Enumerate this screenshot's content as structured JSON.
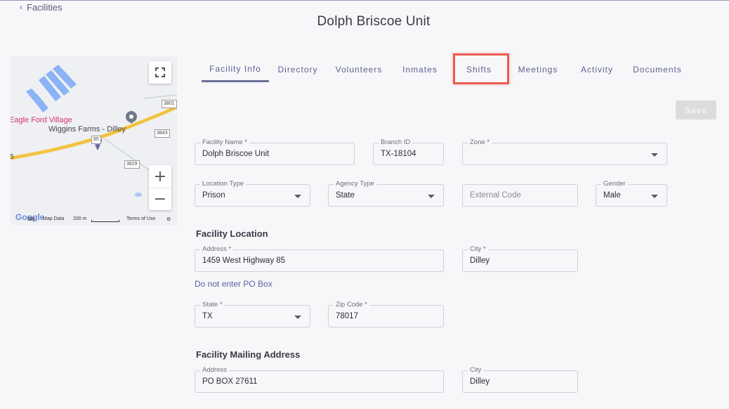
{
  "nav": {
    "back_label": "Facilities"
  },
  "page": {
    "title": "Dolph Briscoe Unit"
  },
  "map": {
    "place_label_1": "Eagle Ford Village",
    "place_label_2": "Wiggins Farms - Dilley",
    "edge_label": "5",
    "road_signs": [
      "3801",
      "3843",
      "85",
      "3829"
    ],
    "map_data_label": "Map Data",
    "scale_label": "200 m",
    "terms_label": "Terms of Use",
    "logo_text": "Google",
    "zoom_in": "+",
    "zoom_out": "−"
  },
  "tabs": [
    "Facility Info",
    "Directory",
    "Volunteers",
    "Inmates",
    "Shifts",
    "Meetings",
    "Activity",
    "Documents"
  ],
  "active_tab": "Facility Info",
  "highlighted_tab": "Shifts",
  "save_label": "Save",
  "facility_info": {
    "facility_name": {
      "label": "Facility Name *",
      "value": "Dolph Briscoe Unit"
    },
    "branch_id": {
      "label": "Branch ID",
      "value": "TX-18104"
    },
    "zone": {
      "label": "Zone *",
      "value": ""
    },
    "location_type": {
      "label": "Location Type",
      "value": "Prison"
    },
    "agency_type": {
      "label": "Agency Type",
      "value": "State"
    },
    "external_code": {
      "placeholder": "External Code"
    },
    "gender": {
      "label": "Gender",
      "value": "Male"
    }
  },
  "facility_location": {
    "title": "Facility Location",
    "address": {
      "label": "Address *",
      "value": "1459 West Highway 85"
    },
    "city": {
      "label": "City *",
      "value": "Dilley"
    },
    "po_note": "Do not enter PO Box",
    "state": {
      "label": "State *",
      "value": "TX"
    },
    "zip": {
      "label": "Zip Code *",
      "value": "78017"
    }
  },
  "mailing_address": {
    "title": "Facility Mailing Address",
    "address": {
      "label": "Address",
      "value": "PO BOX 27611"
    },
    "city": {
      "label": "City",
      "value": "Dilley"
    }
  },
  "colors": {
    "accent": "#6c6e9a",
    "highlight": "#ec5a4f",
    "tab_text": "#5b5f8f",
    "road": "#f6c94b",
    "pin": "#6f6a9a",
    "building": "#8bb3f5"
  }
}
